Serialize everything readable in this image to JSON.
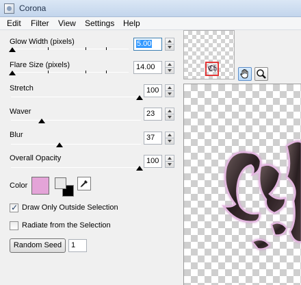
{
  "window": {
    "title": "Corona"
  },
  "menu": [
    "Edit",
    "Filter",
    "View",
    "Settings",
    "Help"
  ],
  "sliders": [
    {
      "label": "Glow Width (pixels)",
      "value": "5.00",
      "level": 0.0,
      "selected": true
    },
    {
      "label": "Flare Size (pixels)",
      "value": "14.00",
      "level": 0.0,
      "selected": false
    },
    {
      "label": "Stretch",
      "value": "100",
      "level": 1.0,
      "selected": false
    },
    {
      "label": "Waver",
      "value": "23",
      "level": 0.23,
      "selected": false
    },
    {
      "label": "Blur",
      "value": "37",
      "level": 0.37,
      "selected": false
    },
    {
      "label": "Overall Opacity",
      "value": "100",
      "level": 1.0,
      "selected": false
    }
  ],
  "color": {
    "label": "Color",
    "swatch": "#e4a4d8"
  },
  "options": [
    {
      "label": "Draw Only Outside Selection",
      "checked": true
    },
    {
      "label": "Radiate from the Selection",
      "checked": false
    }
  ],
  "seed": {
    "button_label": "Random Seed",
    "value": "1"
  },
  "preview": {
    "tools": [
      "hand-icon",
      "zoom-icon"
    ]
  }
}
